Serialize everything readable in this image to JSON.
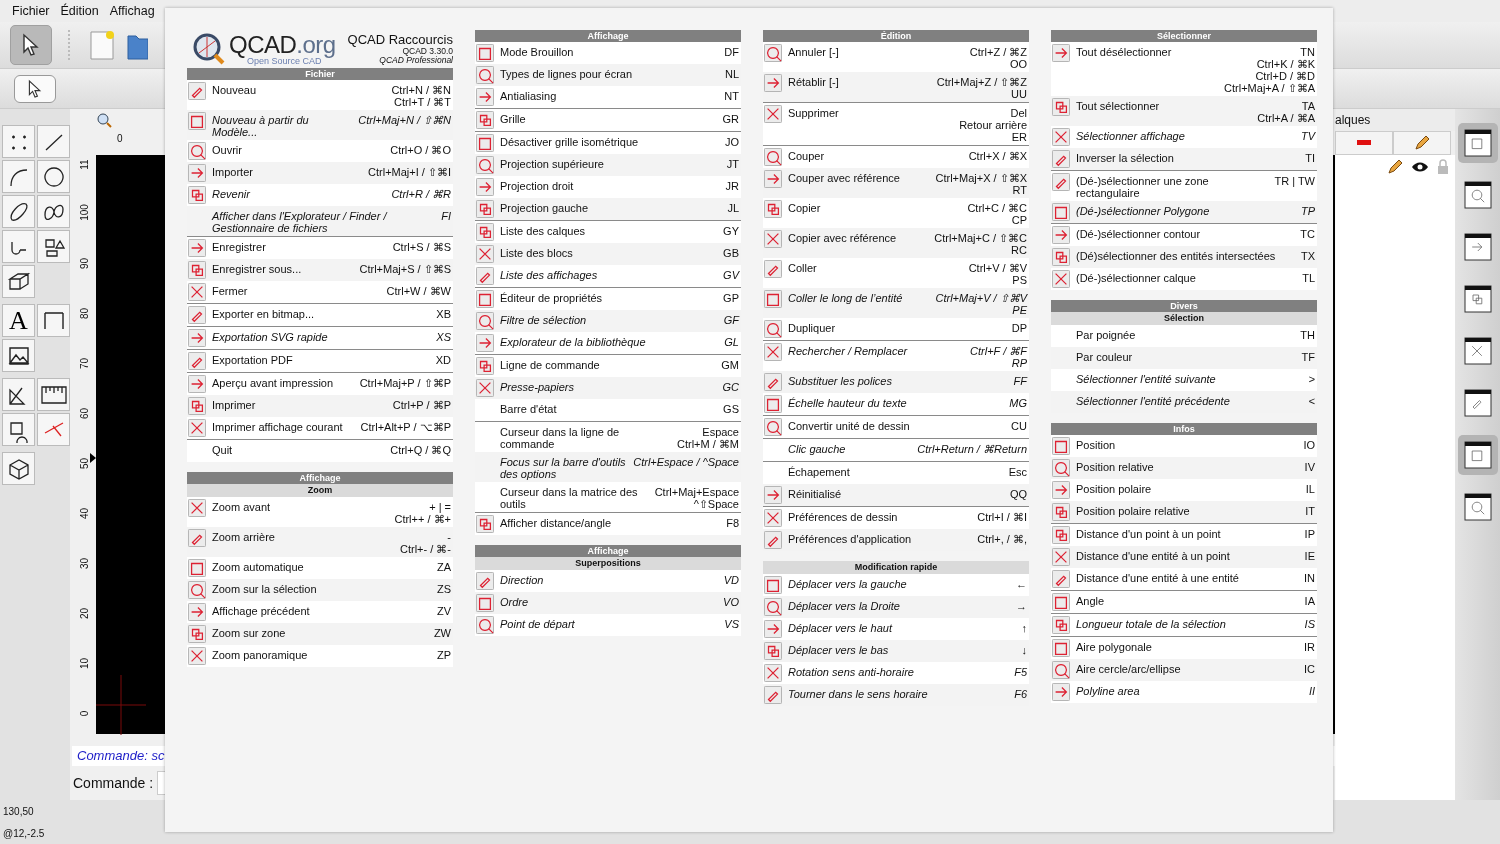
{
  "menu_bar": [
    "Fichier",
    "Édition",
    "Affichag"
  ],
  "palette_text_tool": "A",
  "top_ruler": "0",
  "left_ruler": [
    "11",
    "100",
    "90",
    "80",
    "70",
    "60",
    "50",
    "40",
    "30",
    "20",
    "10",
    "0"
  ],
  "command_log": "Commande: sc",
  "command_label": "Commande :",
  "layers_panel": {
    "title": "alques"
  },
  "status_bar": [
    "130,50",
    "@12,-2.5"
  ],
  "dialog": {
    "logo": {
      "name": "QCAD",
      "suffix": ".org",
      "tagline": "Open Source CAD"
    },
    "title": "QCAD Raccourcis",
    "version": "QCAD 3.30.0",
    "edition": "QCAD Professional",
    "columns": [
      {
        "sections": [
          {
            "title": "Fichier",
            "groups": [
              {
                "rows": [
                  {
                    "label": "Nouveau",
                    "keys": [
                      "Ctrl+N / ⌘N",
                      "Ctrl+T / ⌘T"
                    ],
                    "italic": false,
                    "icon": true
                  },
                  {
                    "label": "Nouveau à partir du Modèle...",
                    "keys": [
                      "Ctrl+Maj+N / ⇧⌘N"
                    ],
                    "italic": true,
                    "icon": true
                  },
                  {
                    "label": "Ouvrir",
                    "keys": [
                      "Ctrl+O / ⌘O"
                    ],
                    "italic": false,
                    "icon": true
                  },
                  {
                    "label": "Importer",
                    "keys": [
                      "Ctrl+Maj+I / ⇧⌘I"
                    ],
                    "italic": false,
                    "icon": true
                  },
                  {
                    "label": "Revenir",
                    "keys": [
                      "Ctrl+R / ⌘R"
                    ],
                    "italic": true,
                    "icon": true
                  },
                  {
                    "label": "Afficher dans l'Explorateur / Finder / Gestionnaire de fichiers",
                    "keys": [
                      "FI"
                    ],
                    "italic": true,
                    "icon": false
                  }
                ]
              },
              {
                "rows": [
                  {
                    "label": "Enregistrer",
                    "keys": [
                      "Ctrl+S / ⌘S"
                    ],
                    "italic": false,
                    "icon": true
                  },
                  {
                    "label": "Enregistrer sous...",
                    "keys": [
                      "Ctrl+Maj+S / ⇧⌘S"
                    ],
                    "italic": false,
                    "icon": true
                  },
                  {
                    "label": "Fermer",
                    "keys": [
                      "Ctrl+W / ⌘W"
                    ],
                    "italic": false,
                    "icon": true
                  }
                ]
              },
              {
                "rows": [
                  {
                    "label": "Exporter en bitmap...",
                    "keys": [
                      "XB"
                    ],
                    "italic": false,
                    "icon": true
                  }
                ]
              },
              {
                "rows": [
                  {
                    "label": "Exportation SVG rapide",
                    "keys": [
                      "XS"
                    ],
                    "italic": true,
                    "icon": true
                  }
                ]
              },
              {
                "rows": [
                  {
                    "label": "Exportation PDF",
                    "keys": [
                      "XD"
                    ],
                    "italic": false,
                    "icon": true
                  }
                ]
              },
              {
                "rows": [
                  {
                    "label": "Aperçu avant impression",
                    "keys": [
                      "Ctrl+Maj+P / ⇧⌘P"
                    ],
                    "italic": false,
                    "icon": true
                  },
                  {
                    "label": "Imprimer",
                    "keys": [
                      "Ctrl+P / ⌘P"
                    ],
                    "italic": false,
                    "icon": true
                  },
                  {
                    "label": "Imprimer affichage courant",
                    "keys": [
                      "Ctrl+Alt+P / ⌥⌘P"
                    ],
                    "italic": false,
                    "icon": true
                  }
                ]
              },
              {
                "rows": [
                  {
                    "label": "Quit",
                    "keys": [
                      "Ctrl+Q / ⌘Q"
                    ],
                    "italic": false,
                    "icon": false
                  }
                ]
              }
            ]
          },
          {
            "title": "Affichage",
            "subtitle": "Zoom",
            "groups": [
              {
                "rows": [
                  {
                    "label": "Zoom avant",
                    "keys": [
                      "+ | =",
                      "Ctrl++ / ⌘+"
                    ],
                    "italic": false,
                    "icon": true
                  },
                  {
                    "label": "Zoom arrière",
                    "keys": [
                      "-",
                      "Ctrl+- / ⌘-"
                    ],
                    "italic": false,
                    "icon": true
                  },
                  {
                    "label": "Zoom automatique",
                    "keys": [
                      "ZA"
                    ],
                    "italic": false,
                    "icon": true
                  },
                  {
                    "label": "Zoom sur la sélection",
                    "keys": [
                      "ZS"
                    ],
                    "italic": false,
                    "icon": true
                  },
                  {
                    "label": "Affichage précédent",
                    "keys": [
                      "ZV"
                    ],
                    "italic": false,
                    "icon": true
                  },
                  {
                    "label": "Zoom sur zone",
                    "keys": [
                      "ZW"
                    ],
                    "italic": false,
                    "icon": true
                  },
                  {
                    "label": "Zoom panoramique",
                    "keys": [
                      "ZP"
                    ],
                    "italic": false,
                    "icon": true
                  }
                ]
              }
            ]
          }
        ]
      },
      {
        "sections": [
          {
            "title": "Affichage",
            "groups": [
              {
                "rows": [
                  {
                    "label": "Mode Brouillon",
                    "keys": [
                      "DF"
                    ],
                    "italic": false,
                    "icon": true
                  },
                  {
                    "label": "Types de lignes pour écran",
                    "keys": [
                      "NL"
                    ],
                    "italic": false,
                    "icon": true
                  },
                  {
                    "label": "Antialiasing",
                    "keys": [
                      "NT"
                    ],
                    "italic": false,
                    "icon": true
                  }
                ]
              },
              {
                "rows": [
                  {
                    "label": "Grille",
                    "keys": [
                      "GR"
                    ],
                    "italic": false,
                    "icon": true
                  }
                ]
              },
              {
                "rows": [
                  {
                    "label": "Désactiver grille isométrique",
                    "keys": [
                      "JO"
                    ],
                    "italic": false,
                    "icon": true
                  },
                  {
                    "label": "Projection supérieure",
                    "keys": [
                      "JT"
                    ],
                    "italic": false,
                    "icon": true
                  },
                  {
                    "label": "Projection droit",
                    "keys": [
                      "JR"
                    ],
                    "italic": false,
                    "icon": true
                  },
                  {
                    "label": "Projection gauche",
                    "keys": [
                      "JL"
                    ],
                    "italic": false,
                    "icon": true
                  }
                ]
              },
              {
                "rows": [
                  {
                    "label": "Liste des calques",
                    "keys": [
                      "GY"
                    ],
                    "italic": false,
                    "icon": true
                  },
                  {
                    "label": "Liste des blocs",
                    "keys": [
                      "GB"
                    ],
                    "italic": false,
                    "icon": true
                  },
                  {
                    "label": "Liste des affichages",
                    "keys": [
                      "GV"
                    ],
                    "italic": true,
                    "icon": true
                  }
                ]
              },
              {
                "rows": [
                  {
                    "label": "Éditeur de propriétés",
                    "keys": [
                      "GP"
                    ],
                    "italic": false,
                    "icon": true
                  },
                  {
                    "label": "Filtre de sélection",
                    "keys": [
                      "GF"
                    ],
                    "italic": true,
                    "icon": true
                  },
                  {
                    "label": "Explorateur de la bibliothèque",
                    "keys": [
                      "GL"
                    ],
                    "italic": true,
                    "icon": true
                  }
                ]
              },
              {
                "rows": [
                  {
                    "label": "Ligne de commande",
                    "keys": [
                      "GM"
                    ],
                    "italic": false,
                    "icon": true
                  },
                  {
                    "label": "Presse-papiers",
                    "keys": [
                      "GC"
                    ],
                    "italic": true,
                    "icon": true
                  },
                  {
                    "label": "Barre d'état",
                    "keys": [
                      "GS"
                    ],
                    "italic": false,
                    "icon": false
                  }
                ]
              },
              {
                "rows": [
                  {
                    "label": "Curseur dans la ligne de commande",
                    "keys": [
                      "Espace",
                      "Ctrl+M / ⌘M"
                    ],
                    "italic": false,
                    "icon": false
                  },
                  {
                    "label": "Focus sur la barre d'outils des options",
                    "keys": [
                      "Ctrl+Espace / ^Space"
                    ],
                    "italic": true,
                    "icon": false
                  },
                  {
                    "label": "Curseur dans la matrice des outils",
                    "keys": [
                      "Ctrl+Maj+Espace",
                      "^⇧Space"
                    ],
                    "italic": false,
                    "icon": false
                  }
                ]
              },
              {
                "rows": [
                  {
                    "label": "Afficher distance/angle",
                    "keys": [
                      "F8"
                    ],
                    "italic": false,
                    "icon": true
                  }
                ]
              }
            ]
          },
          {
            "title": "Affichage",
            "subtitle": "Superpositions",
            "groups": [
              {
                "rows": [
                  {
                    "label": "Direction",
                    "keys": [
                      "VD"
                    ],
                    "italic": true,
                    "icon": true
                  },
                  {
                    "label": "Ordre",
                    "keys": [
                      "VO"
                    ],
                    "italic": true,
                    "icon": true
                  },
                  {
                    "label": "Point de départ",
                    "keys": [
                      "VS"
                    ],
                    "italic": true,
                    "icon": true
                  }
                ]
              }
            ]
          }
        ]
      },
      {
        "sections": [
          {
            "title": "Édition",
            "groups": [
              {
                "rows": [
                  {
                    "label": "Annuler [-]",
                    "keys": [
                      "Ctrl+Z / ⌘Z",
                      "OO"
                    ],
                    "italic": false,
                    "icon": true
                  },
                  {
                    "label": "Rétablir [-]",
                    "keys": [
                      "Ctrl+Maj+Z / ⇧⌘Z",
                      "UU"
                    ],
                    "italic": false,
                    "icon": true
                  }
                ]
              },
              {
                "rows": [
                  {
                    "label": "Supprimer",
                    "keys": [
                      "Del",
                      "Retour arrière",
                      "ER"
                    ],
                    "italic": false,
                    "icon": true
                  }
                ]
              },
              {
                "rows": [
                  {
                    "label": "Couper",
                    "keys": [
                      "Ctrl+X / ⌘X"
                    ],
                    "italic": false,
                    "icon": true
                  },
                  {
                    "label": "Couper avec référence",
                    "keys": [
                      "Ctrl+Maj+X / ⇧⌘X",
                      "RT"
                    ],
                    "italic": false,
                    "icon": true
                  },
                  {
                    "label": "Copier",
                    "keys": [
                      "Ctrl+C / ⌘C",
                      "CP"
                    ],
                    "italic": false,
                    "icon": true
                  },
                  {
                    "label": "Copier avec référence",
                    "keys": [
                      "Ctrl+Maj+C / ⇧⌘C",
                      "RC"
                    ],
                    "italic": false,
                    "icon": true
                  },
                  {
                    "label": "Coller",
                    "keys": [
                      "Ctrl+V / ⌘V",
                      "PS"
                    ],
                    "italic": false,
                    "icon": true
                  },
                  {
                    "label": "Coller le long de l’entité",
                    "keys": [
                      "Ctrl+Maj+V / ⇧⌘V",
                      "PE"
                    ],
                    "italic": true,
                    "icon": true
                  },
                  {
                    "label": "Dupliquer",
                    "keys": [
                      "DP"
                    ],
                    "italic": false,
                    "icon": true
                  }
                ]
              },
              {
                "rows": [
                  {
                    "label": "Rechercher / Remplacer",
                    "keys": [
                      "Ctrl+F / ⌘F",
                      "RP"
                    ],
                    "italic": true,
                    "icon": true
                  },
                  {
                    "label": "Substituer les polices",
                    "keys": [
                      "FF"
                    ],
                    "italic": true,
                    "icon": true
                  },
                  {
                    "label": "Échelle hauteur du texte",
                    "keys": [
                      "MG"
                    ],
                    "italic": true,
                    "icon": true
                  }
                ]
              },
              {
                "rows": [
                  {
                    "label": "Convertir unité de dessin",
                    "keys": [
                      "CU"
                    ],
                    "italic": false,
                    "icon": true
                  }
                ]
              },
              {
                "rows": [
                  {
                    "label": "Clic gauche",
                    "keys": [
                      "Ctrl+Return / ⌘Return"
                    ],
                    "italic": true,
                    "icon": false
                  }
                ]
              },
              {
                "rows": [
                  {
                    "label": "Échapement",
                    "keys": [
                      "Esc"
                    ],
                    "italic": false,
                    "icon": false
                  },
                  {
                    "label": "Réinitialisé",
                    "keys": [
                      "QQ"
                    ],
                    "italic": false,
                    "icon": true
                  }
                ]
              },
              {
                "rows": [
                  {
                    "label": "Préférences de dessin",
                    "keys": [
                      "Ctrl+I / ⌘I"
                    ],
                    "italic": false,
                    "icon": true
                  },
                  {
                    "label": "Préférences d'application",
                    "keys": [
                      "Ctrl+, / ⌘,"
                    ],
                    "italic": false,
                    "icon": true
                  }
                ]
              }
            ]
          },
          {
            "subtitle": "Modification rapide",
            "groups": [
              {
                "rows": [
                  {
                    "label": "Déplacer vers la gauche",
                    "keys": [
                      "←"
                    ],
                    "italic": true,
                    "icon": true
                  },
                  {
                    "label": "Déplacer vers la Droite",
                    "keys": [
                      "→"
                    ],
                    "italic": true,
                    "icon": true
                  },
                  {
                    "label": "Déplacer vers le haut",
                    "keys": [
                      "↑"
                    ],
                    "italic": true,
                    "icon": true
                  },
                  {
                    "label": "Déplacer vers le bas",
                    "keys": [
                      "↓"
                    ],
                    "italic": true,
                    "icon": true
                  },
                  {
                    "label": "Rotation sens anti-horaire",
                    "keys": [
                      "F5"
                    ],
                    "italic": true,
                    "icon": true
                  },
                  {
                    "label": "Tourner dans le sens horaire",
                    "keys": [
                      "F6"
                    ],
                    "italic": true,
                    "icon": true
                  }
                ]
              }
            ]
          }
        ]
      },
      {
        "sections": [
          {
            "title": "Sélectionner",
            "groups": [
              {
                "rows": [
                  {
                    "label": "Tout désélectionner",
                    "keys": [
                      "TN",
                      "Ctrl+K / ⌘K",
                      "Ctrl+D / ⌘D",
                      "Ctrl+Maj+A / ⇧⌘A"
                    ],
                    "italic": false,
                    "icon": true
                  },
                  {
                    "label": "Tout sélectionner",
                    "keys": [
                      "TA",
                      "Ctrl+A / ⌘A"
                    ],
                    "italic": false,
                    "icon": true
                  },
                  {
                    "label": "Sélectionner affichage",
                    "keys": [
                      "TV"
                    ],
                    "italic": true,
                    "icon": true
                  },
                  {
                    "label": "Inverser la sélection",
                    "keys": [
                      "TI"
                    ],
                    "italic": false,
                    "icon": true
                  }
                ]
              },
              {
                "rows": [
                  {
                    "label": "(Dé-)sélectionner une zone rectangulaire",
                    "keys": [
                      "TR | TW"
                    ],
                    "italic": false,
                    "icon": true
                  },
                  {
                    "label": "(Dé-)sélectionner Polygone",
                    "keys": [
                      "TP"
                    ],
                    "italic": true,
                    "icon": true
                  }
                ]
              },
              {
                "rows": [
                  {
                    "label": "(Dé-)sélectionner contour",
                    "keys": [
                      "TC"
                    ],
                    "italic": false,
                    "icon": true
                  },
                  {
                    "label": "(Dé)sélectionner des entités intersectées",
                    "keys": [
                      "TX"
                    ],
                    "italic": false,
                    "icon": true
                  },
                  {
                    "label": "(Dé-)sélectionner calque",
                    "keys": [
                      "TL"
                    ],
                    "italic": false,
                    "icon": true
                  }
                ]
              }
            ]
          },
          {
            "title": "Divers",
            "subtitle": "Sélection",
            "groups": [
              {
                "rows": [
                  {
                    "label": "Par poignée",
                    "keys": [
                      "TH"
                    ],
                    "italic": false,
                    "icon": false
                  },
                  {
                    "label": "Par couleur",
                    "keys": [
                      "TF"
                    ],
                    "italic": false,
                    "icon": false
                  },
                  {
                    "label": "Sélectionner l'entité suivante",
                    "keys": [
                      ">"
                    ],
                    "italic": true,
                    "icon": false
                  },
                  {
                    "label": "Sélectionner l'entité précédente",
                    "keys": [
                      "<"
                    ],
                    "italic": true,
                    "icon": false
                  }
                ]
              }
            ]
          },
          {
            "title": "Infos",
            "groups": [
              {
                "rows": [
                  {
                    "label": "Position",
                    "keys": [
                      "IO"
                    ],
                    "italic": false,
                    "icon": true
                  },
                  {
                    "label": "Position relative",
                    "keys": [
                      "IV"
                    ],
                    "italic": false,
                    "icon": true
                  },
                  {
                    "label": "Position polaire",
                    "keys": [
                      "IL"
                    ],
                    "italic": false,
                    "icon": true
                  },
                  {
                    "label": "Position polaire relative",
                    "keys": [
                      "IT"
                    ],
                    "italic": false,
                    "icon": true
                  }
                ]
              },
              {
                "rows": [
                  {
                    "label": "Distance d'un point à un point",
                    "keys": [
                      "IP"
                    ],
                    "italic": false,
                    "icon": true
                  },
                  {
                    "label": "Distance d'une entité à un point",
                    "keys": [
                      "IE"
                    ],
                    "italic": false,
                    "icon": true
                  },
                  {
                    "label": "Distance d'une entité à une entité",
                    "keys": [
                      "IN"
                    ],
                    "italic": false,
                    "icon": true
                  }
                ]
              },
              {
                "rows": [
                  {
                    "label": "Angle",
                    "keys": [
                      "IA"
                    ],
                    "italic": false,
                    "icon": true
                  }
                ]
              },
              {
                "rows": [
                  {
                    "label": "Longueur totale de la sélection",
                    "keys": [
                      "IS"
                    ],
                    "italic": true,
                    "icon": true
                  }
                ]
              },
              {
                "rows": [
                  {
                    "label": "Aire polygonale",
                    "keys": [
                      "IR"
                    ],
                    "italic": false,
                    "icon": true
                  },
                  {
                    "label": "Aire cercle/arc/ellipse",
                    "keys": [
                      "IC"
                    ],
                    "italic": false,
                    "icon": true
                  },
                  {
                    "label": "Polyline area",
                    "keys": [
                      "II"
                    ],
                    "italic": true,
                    "icon": true
                  }
                ]
              }
            ]
          }
        ]
      }
    ]
  }
}
